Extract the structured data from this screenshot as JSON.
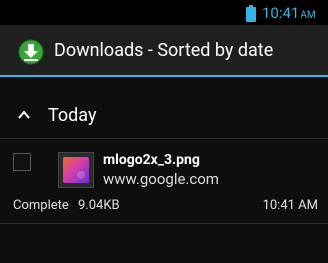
{
  "status_bar": {
    "time": "10:41",
    "ampm": "AM"
  },
  "action_bar": {
    "title": "Downloads - Sorted by date"
  },
  "sections": [
    {
      "header": "Today",
      "items": [
        {
          "file_name": "mlogo2x_3.png",
          "source": "www.google.com",
          "status": "Complete",
          "size": "9.04KB",
          "time": "10:41 AM"
        }
      ]
    }
  ],
  "colors": {
    "accent": "#33b5e5",
    "actionbar": "#1f1f1f",
    "background": "#0e0e0e"
  }
}
